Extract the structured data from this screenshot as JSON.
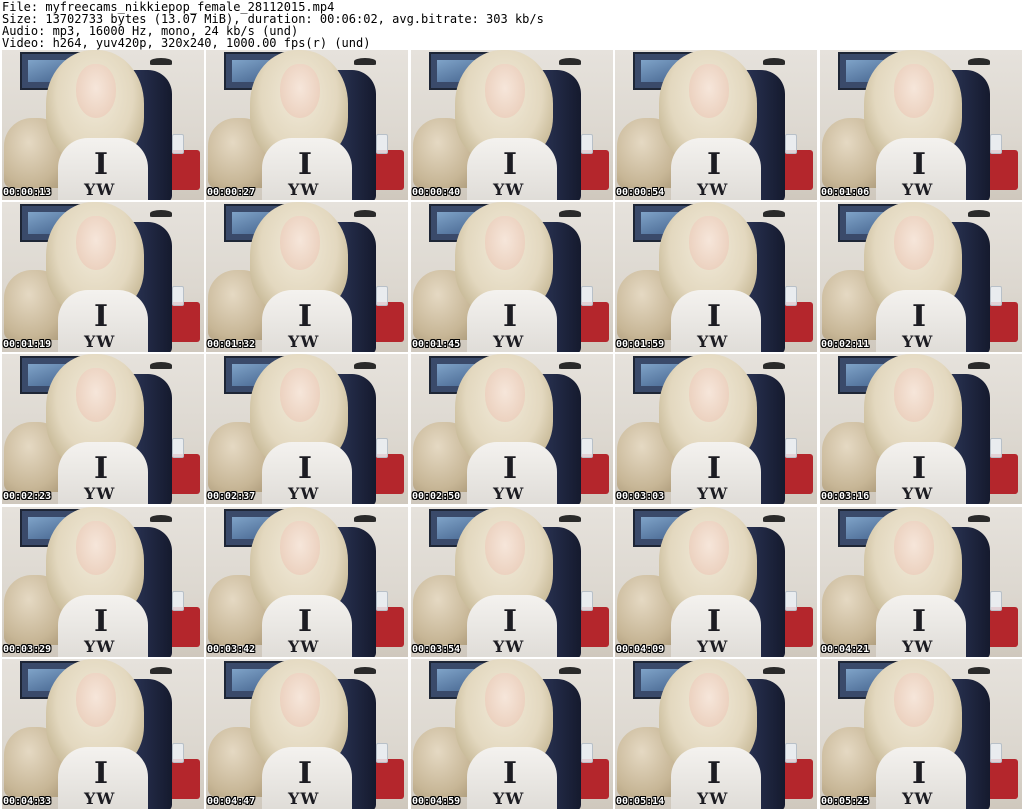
{
  "header": {
    "file_line": "File: myfreecams_nikkiepop_female_28112015.mp4",
    "size_line": "Size: 13702733 bytes (13.07 MiB), duration: 00:06:02, avg.bitrate: 303 kb/s",
    "audio_line": "Audio: mp3, 16000 Hz, mono, 24 kb/s (und)",
    "video_line": "Video: h264, yuv420p, 320x240, 1000.00 fps(r) (und)"
  },
  "thumbnails": [
    {
      "timestamp": "00:00:13"
    },
    {
      "timestamp": "00:00:27"
    },
    {
      "timestamp": "00:00:40"
    },
    {
      "timestamp": "00:00:54"
    },
    {
      "timestamp": "00:01:06"
    },
    {
      "timestamp": "00:01:19"
    },
    {
      "timestamp": "00:01:32"
    },
    {
      "timestamp": "00:01:45"
    },
    {
      "timestamp": "00:01:59"
    },
    {
      "timestamp": "00:02:11"
    },
    {
      "timestamp": "00:02:23"
    },
    {
      "timestamp": "00:02:37"
    },
    {
      "timestamp": "00:02:50"
    },
    {
      "timestamp": "00:03:03"
    },
    {
      "timestamp": "00:03:16"
    },
    {
      "timestamp": "00:03:29"
    },
    {
      "timestamp": "00:03:42"
    },
    {
      "timestamp": "00:03:54"
    },
    {
      "timestamp": "00:04:09"
    },
    {
      "timestamp": "00:04:21"
    },
    {
      "timestamp": "00:04:33"
    },
    {
      "timestamp": "00:04:47"
    },
    {
      "timestamp": "00:04:59"
    },
    {
      "timestamp": "00:05:14"
    },
    {
      "timestamp": "00:05:25"
    }
  ]
}
